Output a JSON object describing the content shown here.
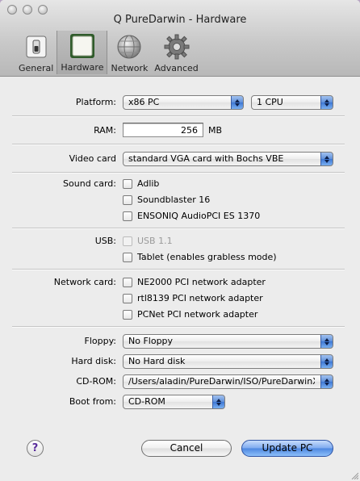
{
  "window": {
    "title": "Q PureDarwin - Hardware"
  },
  "toolbar": {
    "items": [
      {
        "label": "General",
        "icon": "switch-icon"
      },
      {
        "label": "Hardware",
        "icon": "chip-icon",
        "selected": true
      },
      {
        "label": "Network",
        "icon": "globe-icon"
      },
      {
        "label": "Advanced",
        "icon": "gear-icon"
      }
    ]
  },
  "form": {
    "platform": {
      "label": "Platform:",
      "value": "x86 PC",
      "cpu": "1 CPU"
    },
    "ram": {
      "label": "RAM:",
      "value": "256",
      "unit": "MB"
    },
    "video": {
      "label": "Video card",
      "value": "standard VGA card with Bochs VBE"
    },
    "sound": {
      "label": "Sound card:",
      "options": [
        {
          "label": "Adlib",
          "checked": false
        },
        {
          "label": "Soundblaster 16",
          "checked": false
        },
        {
          "label": "ENSONIQ AudioPCI ES 1370",
          "checked": false
        }
      ]
    },
    "usb": {
      "label": "USB:",
      "usb11": {
        "label": "USB 1.1",
        "checked": false,
        "disabled": true
      },
      "tablet": {
        "label": "Tablet (enables grabless mode)",
        "checked": false
      }
    },
    "network": {
      "label": "Network card:",
      "options": [
        {
          "label": "NE2000 PCI network adapter",
          "checked": false
        },
        {
          "label": "rtl8139 PCI network adapter",
          "checked": false
        },
        {
          "label": "PCNet PCI network adapter",
          "checked": false
        }
      ]
    },
    "floppy": {
      "label": "Floppy:",
      "value": "No Floppy"
    },
    "harddisk": {
      "label": "Hard disk:",
      "value": "No Hard disk"
    },
    "cdrom": {
      "label": "CD-ROM:",
      "value": "/Users/aladin/PureDarwin/ISO/PureDarwinXmas.iso"
    },
    "boot": {
      "label": "Boot from:",
      "value": "CD-ROM"
    }
  },
  "buttons": {
    "help": "?",
    "cancel": "Cancel",
    "update": "Update PC"
  },
  "colors": {
    "accent": "#4c86e0",
    "background": "#ececec"
  }
}
